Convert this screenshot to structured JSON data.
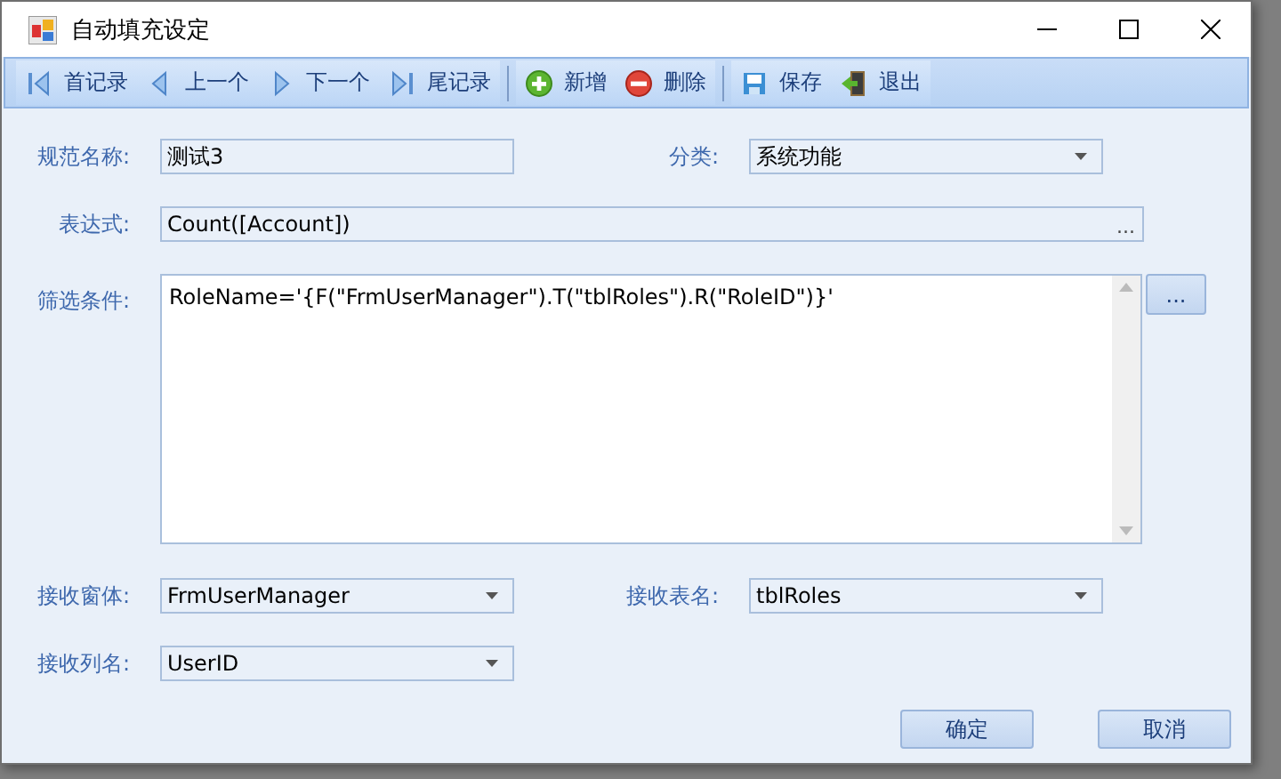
{
  "window": {
    "title": "自动填充设定"
  },
  "toolbar": {
    "groups": [
      [
        {
          "kind": "first",
          "label": "首记录"
        },
        {
          "kind": "prev",
          "label": "上一个"
        },
        {
          "kind": "next",
          "label": "下一个"
        },
        {
          "kind": "last",
          "label": "尾记录"
        }
      ],
      [
        {
          "kind": "add",
          "label": "新增"
        },
        {
          "kind": "delete",
          "label": "删除"
        }
      ],
      [
        {
          "kind": "save",
          "label": "保存"
        },
        {
          "kind": "exit",
          "label": "退出"
        }
      ]
    ]
  },
  "form": {
    "rows": [
      [
        {
          "label": "规范名称:",
          "kind": "text",
          "value": "测试3"
        },
        {
          "label": "分类:",
          "kind": "combo",
          "value": "系统功能"
        }
      ],
      [
        {
          "label": "表达式:",
          "kind": "ellipsis",
          "value": "Count([Account])",
          "button": "..."
        }
      ],
      [
        {
          "label": "筛选条件:",
          "kind": "memo",
          "value": "RoleName='{F(\"FrmUserManager\").T(\"tblRoles\").R(\"RoleID\")}'",
          "button": "..."
        }
      ],
      [
        {
          "label": "接收窗体:",
          "kind": "combo",
          "value": "FrmUserManager"
        },
        {
          "label": "接收表名:",
          "kind": "combo",
          "value": "tblRoles"
        }
      ],
      [
        {
          "label": "接收列名:",
          "kind": "combo",
          "value": "UserID"
        }
      ]
    ]
  },
  "buttons": [
    "确定",
    "取消"
  ]
}
